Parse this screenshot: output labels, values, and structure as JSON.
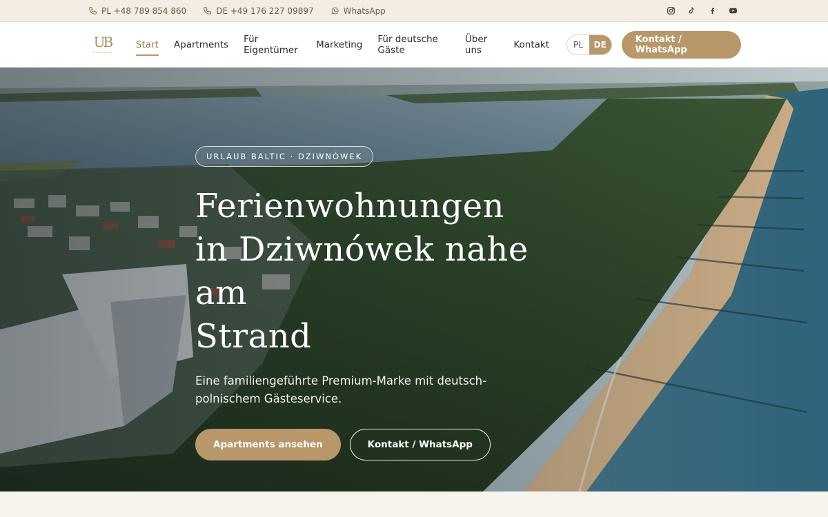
{
  "topbar": {
    "phone_pl": "PL +48 789 854 860",
    "phone_de": "DE +49 176 227 09897",
    "whatsapp": "WhatsApp",
    "socials": [
      "instagram-icon",
      "tiktok-icon",
      "facebook-icon",
      "youtube-icon"
    ]
  },
  "header": {
    "logo_mark": "UB",
    "logo_sub": "URLAUB BALTIC",
    "nav": [
      {
        "label": "Start",
        "active": true
      },
      {
        "label": "Apartments"
      },
      {
        "label": "Für Eigentümer"
      },
      {
        "label": "Marketing"
      },
      {
        "label": "Für deutsche Gäste"
      },
      {
        "label": "Über uns"
      },
      {
        "label": "Kontakt"
      }
    ],
    "lang_pl": "PL",
    "lang_de": "DE",
    "lang_active": "DE",
    "cta": "Kontakt / WhatsApp"
  },
  "hero": {
    "eyebrow": "URLAUB BALTIC · DZIWNÓWEK",
    "title_line1": "Ferienwohnungen",
    "title_line2": "in Dziwnówek nahe am",
    "title_line3": "Strand",
    "subtitle": "Eine familiengeführte Premium-Marke mit deutsch-polnischem Gästeservice.",
    "btn_primary": "Apartments ansehen",
    "btn_secondary": "Kontakt / WhatsApp"
  },
  "colors": {
    "accent": "#b8976a",
    "topbar_bg": "#f3ede3",
    "header_bg": "#ffffff"
  }
}
